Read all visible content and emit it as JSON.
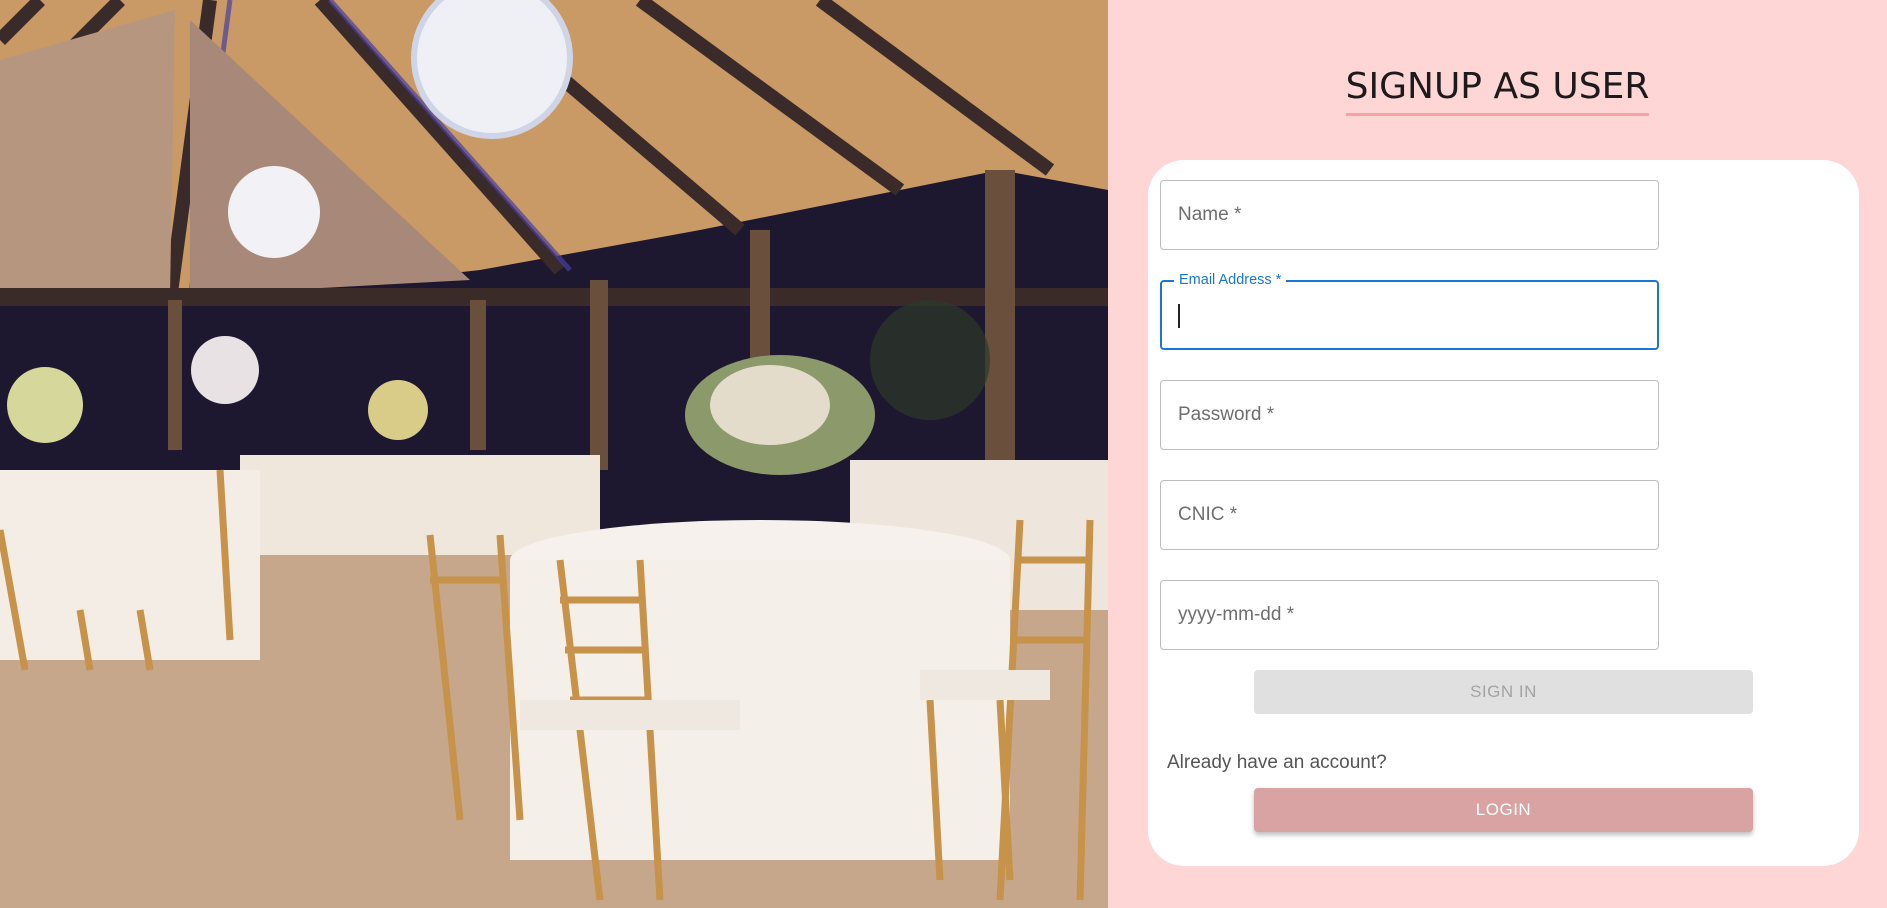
{
  "page": {
    "title": "SIGNUP AS USER"
  },
  "hero_image": {
    "icon": "wedding-venue-photo"
  },
  "form": {
    "name": {
      "placeholder": "Name *"
    },
    "email": {
      "label": "Email Address *",
      "value": ""
    },
    "password": {
      "placeholder": "Password *"
    },
    "cnic": {
      "placeholder": "CNIC *"
    },
    "dob": {
      "placeholder": "yyyy-mm-dd *"
    },
    "signin_label": "SIGN IN",
    "already_text": "Already have an account?",
    "login_label": "LOGIN"
  },
  "colors": {
    "background": "#ffd6d6",
    "card": "#ffffff",
    "accent_underline": "#f5a3a3",
    "focus": "#1976d2",
    "login_button": "#d9a3a3",
    "signin_disabled": "#e0e0e0"
  }
}
